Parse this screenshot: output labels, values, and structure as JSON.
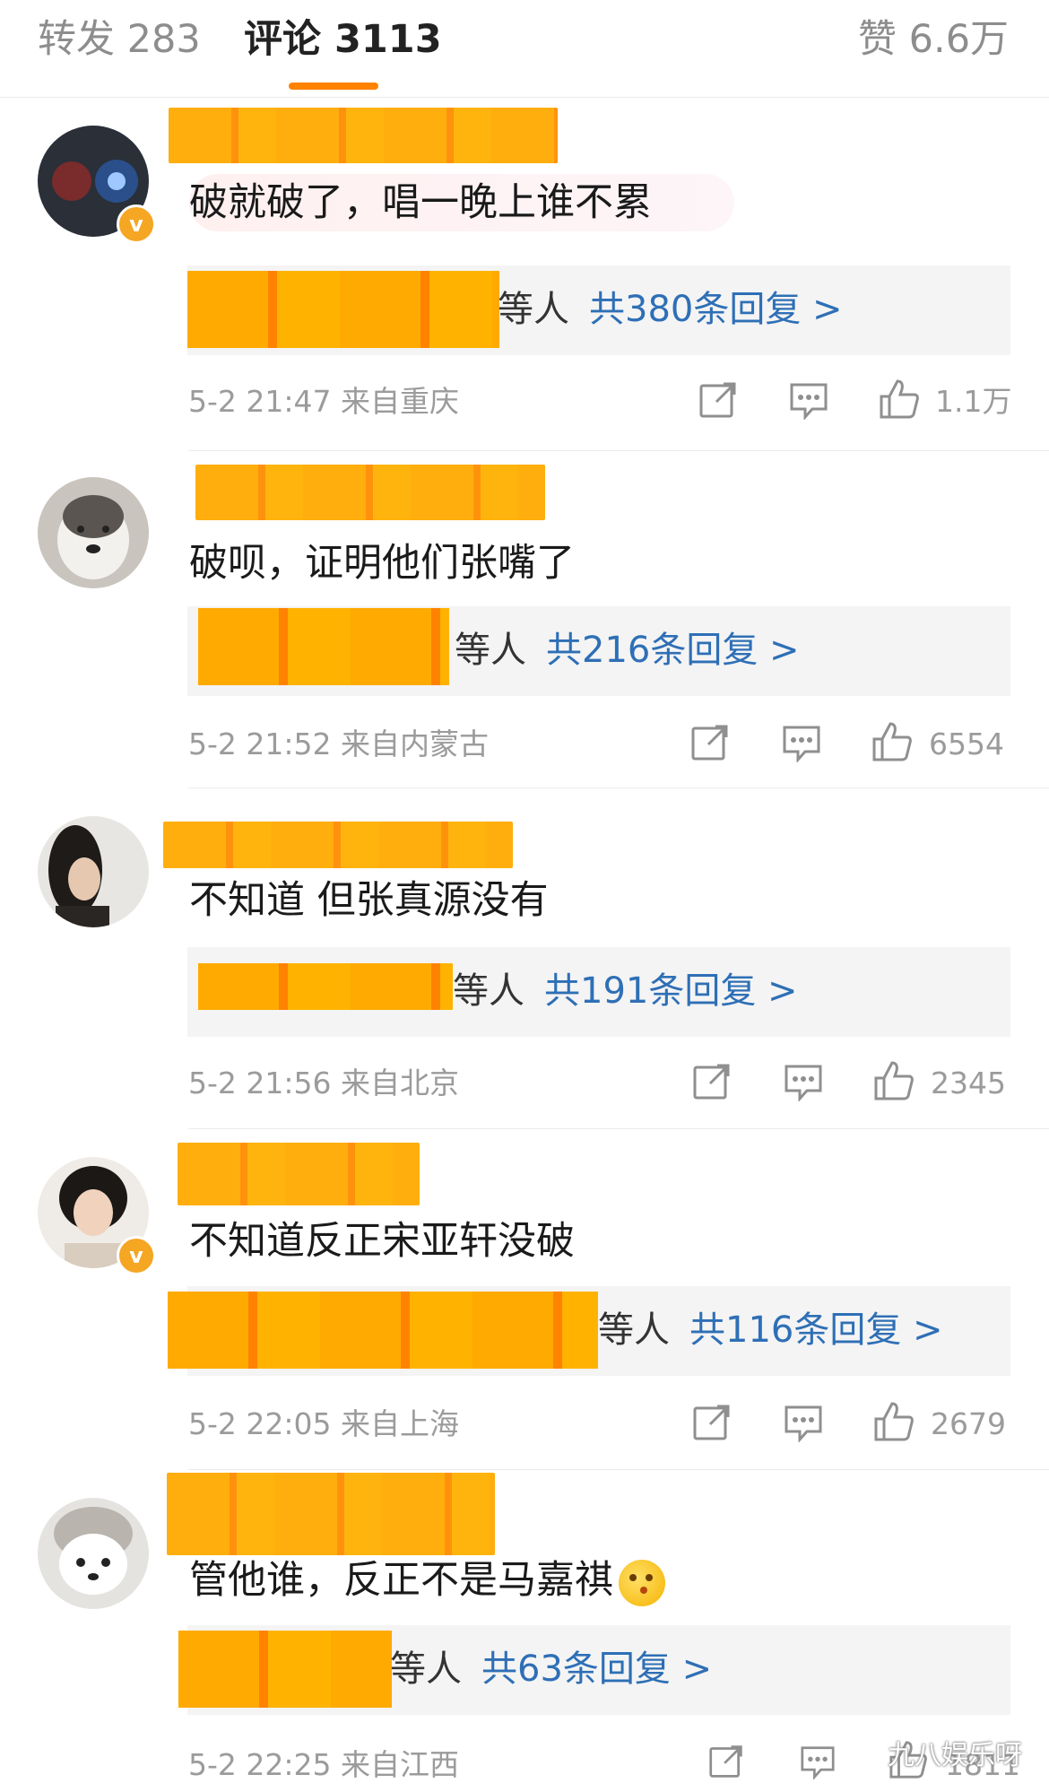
{
  "tabs": {
    "repost": "转发 283",
    "comments": "评论 3113",
    "likes": "赞 6.6万"
  },
  "colors": {
    "accent": "#ff8200",
    "link": "#2e6fb6",
    "verified_badge": "#f5a623"
  },
  "comments": [
    {
      "text": "破就破了，唱一晚上谁不累",
      "verified": true,
      "reply_suffix": "等人",
      "reply_link": "共380条回复 >",
      "time": "5-2 21:47",
      "location": "来自重庆",
      "like_count": "1.1万"
    },
    {
      "text": "破呗，证明他们张嘴了",
      "verified": false,
      "reply_suffix": "等人",
      "reply_link": "共216条回复 >",
      "time": "5-2 21:52",
      "location": "来自内蒙古",
      "like_count": "6554"
    },
    {
      "text": "不知道 但张真源没有",
      "verified": false,
      "reply_suffix": "等人",
      "reply_link": "共191条回复 >",
      "time": "5-2 21:56",
      "location": "来自北京",
      "like_count": "2345"
    },
    {
      "text": "不知道反正宋亚轩没破",
      "verified": true,
      "reply_suffix": "等人",
      "reply_link": "共116条回复 >",
      "time": "5-2 22:05",
      "location": "来自上海",
      "like_count": "2679"
    },
    {
      "text": "管他谁，反正不是马嘉祺",
      "verified": false,
      "reply_suffix": "等人",
      "reply_link": "共63条回复 >",
      "time": "5-2 22:25",
      "location": "来自江西",
      "like_count": "1811"
    }
  ],
  "watermark": "九八娱乐呀"
}
